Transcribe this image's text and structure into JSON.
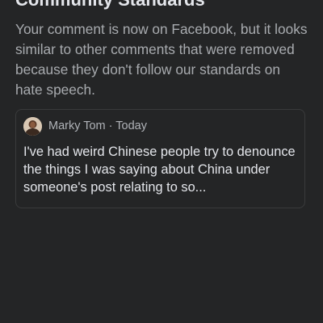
{
  "dialog": {
    "title": "Community Standards",
    "message": "Your comment is now on Facebook, but it looks similar to other comments that were removed because they don't follow our standards on hate speech."
  },
  "comment": {
    "author": "Marky Tom",
    "separator": " · ",
    "time": "Today",
    "text": "I've had weird Chinese people try to denounce the things I was saying about China under someone's post relating to so...",
    "avatar_icon": "user-avatar"
  },
  "colors": {
    "background": "#242526",
    "title": "#e4e6eb",
    "secondary_text": "#a8abaf",
    "card_border": "#3a3b3c"
  }
}
